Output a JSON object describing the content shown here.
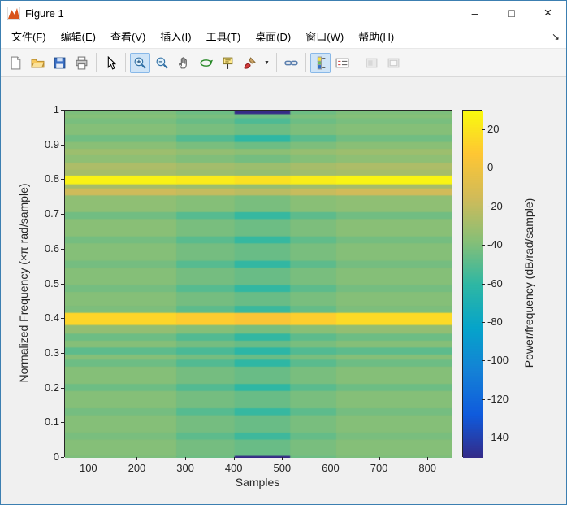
{
  "window": {
    "title": "Figure 1",
    "controls": {
      "minimize": "–",
      "maximize": "□",
      "close": "×"
    }
  },
  "menu": {
    "items": [
      "文件(F)",
      "编辑(E)",
      "查看(V)",
      "插入(I)",
      "工具(T)",
      "桌面(D)",
      "窗口(W)",
      "帮助(H)"
    ],
    "overflow_arrow": "↘"
  },
  "toolbar": {
    "items": [
      {
        "name": "new-figure",
        "icon": "new-document-icon"
      },
      {
        "name": "open-file",
        "icon": "open-folder-icon"
      },
      {
        "name": "save-figure",
        "icon": "save-icon"
      },
      {
        "name": "print-figure",
        "icon": "printer-icon"
      },
      {
        "type": "separator"
      },
      {
        "name": "edit-plot",
        "icon": "pointer-icon"
      },
      {
        "type": "separator"
      },
      {
        "name": "zoom-in",
        "icon": "zoom-in-icon",
        "active": true
      },
      {
        "name": "zoom-out",
        "icon": "zoom-out-icon"
      },
      {
        "name": "pan",
        "icon": "hand-icon"
      },
      {
        "name": "rotate-3d",
        "icon": "rotate-3d-icon"
      },
      {
        "name": "data-cursor",
        "icon": "data-cursor-icon"
      },
      {
        "name": "brush",
        "icon": "brush-icon",
        "dropdown": true
      },
      {
        "type": "separator"
      },
      {
        "name": "link-plot",
        "icon": "link-plot-icon"
      },
      {
        "type": "separator"
      },
      {
        "name": "insert-colorbar",
        "icon": "colorbar-icon",
        "active": true
      },
      {
        "name": "insert-legend",
        "icon": "legend-icon"
      },
      {
        "type": "separator"
      },
      {
        "name": "hide-plot-tools",
        "icon": "hide-plot-tools-icon",
        "disabled": true
      },
      {
        "name": "dock-figure",
        "icon": "dock-figure-icon",
        "disabled": true
      }
    ]
  },
  "chart_data": {
    "type": "heatmap",
    "title": "",
    "xlabel": "Samples",
    "ylabel": "Normalized Frequency (×π rad/sample)",
    "colorbar_label": "Power/frequency (dB/rad/sample)",
    "xlim": [
      50,
      850
    ],
    "ylim": [
      0,
      1
    ],
    "x_ticks": [
      100,
      200,
      300,
      400,
      500,
      600,
      700,
      800
    ],
    "y_ticks": [
      0,
      0.1,
      0.2,
      0.3,
      0.4,
      0.5,
      0.6,
      0.7,
      0.8,
      0.9,
      1
    ],
    "value_range": [
      -150,
      30
    ],
    "colorbar_ticks": [
      20,
      0,
      -20,
      -40,
      -60,
      -80,
      -100,
      -120,
      -140
    ],
    "colormap_stops": [
      [
        0,
        "#352a87"
      ],
      [
        0.125,
        "#0f5bdd"
      ],
      [
        0.25,
        "#1481d6"
      ],
      [
        0.375,
        "#06a4ca"
      ],
      [
        0.5,
        "#2eb7a4"
      ],
      [
        0.625,
        "#87bf77"
      ],
      [
        0.75,
        "#d1bb59"
      ],
      [
        0.875,
        "#fec634"
      ],
      [
        1,
        "#f9fb0e"
      ]
    ],
    "segments_x": [
      50,
      280,
      400,
      515,
      610,
      850
    ],
    "rows_format": "[y0, y1, dB value per x-segment (5 segments)]",
    "rows": [
      [
        0.0,
        0.008,
        -40,
        -44,
        -150,
        -44,
        -40
      ],
      [
        0.008,
        0.055,
        -38,
        -42,
        -45,
        -41,
        -38
      ],
      [
        0.055,
        0.075,
        -41,
        -48,
        -56,
        -46,
        -41
      ],
      [
        0.075,
        0.125,
        -38,
        -42,
        -45,
        -41,
        -38
      ],
      [
        0.125,
        0.145,
        -42,
        -50,
        -58,
        -48,
        -42
      ],
      [
        0.145,
        0.195,
        -38,
        -42,
        -45,
        -41,
        -38
      ],
      [
        0.195,
        0.215,
        -44,
        -51,
        -60,
        -49,
        -44
      ],
      [
        0.215,
        0.265,
        -38,
        -42,
        -45,
        -41,
        -38
      ],
      [
        0.265,
        0.285,
        -44,
        -51,
        -60,
        -49,
        -44
      ],
      [
        0.285,
        0.3,
        -38,
        -42,
        -45,
        -41,
        -38
      ],
      [
        0.3,
        0.32,
        -48,
        -53,
        -61,
        -51,
        -48
      ],
      [
        0.32,
        0.34,
        -38,
        -42,
        -45,
        -41,
        -38
      ],
      [
        0.34,
        0.36,
        -44,
        -51,
        -59,
        -48,
        -44
      ],
      [
        0.36,
        0.385,
        -34,
        -38,
        -41,
        -37,
        -34
      ],
      [
        0.385,
        0.42,
        14,
        10,
        6,
        11,
        16
      ],
      [
        0.42,
        0.44,
        -40,
        -48,
        -57,
        -46,
        -40
      ],
      [
        0.44,
        0.48,
        -38,
        -42,
        -45,
        -41,
        -38
      ],
      [
        0.48,
        0.5,
        -42,
        -50,
        -59,
        -48,
        -42
      ],
      [
        0.5,
        0.55,
        -38,
        -42,
        -45,
        -41,
        -38
      ],
      [
        0.55,
        0.57,
        -42,
        -50,
        -59,
        -48,
        -42
      ],
      [
        0.57,
        0.62,
        -38,
        -42,
        -45,
        -41,
        -38
      ],
      [
        0.62,
        0.64,
        -42,
        -49,
        -58,
        -47,
        -42
      ],
      [
        0.64,
        0.69,
        -37,
        -41,
        -44,
        -40,
        -37
      ],
      [
        0.69,
        0.71,
        -43,
        -50,
        -58,
        -48,
        -43
      ],
      [
        0.71,
        0.758,
        -35,
        -38,
        -41,
        -37,
        -35
      ],
      [
        0.758,
        0.778,
        -16,
        -19,
        -22,
        -18,
        -15
      ],
      [
        0.778,
        0.79,
        -28,
        -31,
        -33,
        -30,
        -28
      ],
      [
        0.79,
        0.815,
        26,
        23,
        19,
        24,
        27
      ],
      [
        0.815,
        0.832,
        -28,
        -31,
        -33,
        -30,
        -28
      ],
      [
        0.832,
        0.852,
        -26,
        -29,
        -31,
        -28,
        -26
      ],
      [
        0.852,
        0.876,
        -35,
        -39,
        -42,
        -38,
        -35
      ],
      [
        0.876,
        0.892,
        -31,
        -34,
        -36,
        -33,
        -31
      ],
      [
        0.892,
        0.912,
        -37,
        -41,
        -44,
        -40,
        -37
      ],
      [
        0.912,
        0.932,
        -43,
        -51,
        -60,
        -49,
        -43
      ],
      [
        0.932,
        0.965,
        -38,
        -41,
        -44,
        -40,
        -38
      ],
      [
        0.965,
        0.98,
        -41,
        -45,
        -52,
        -44,
        -41
      ],
      [
        0.98,
        0.992,
        -38,
        -41,
        -44,
        -40,
        -38
      ],
      [
        0.992,
        1.0,
        -40,
        -44,
        -150,
        -44,
        -40
      ]
    ]
  }
}
